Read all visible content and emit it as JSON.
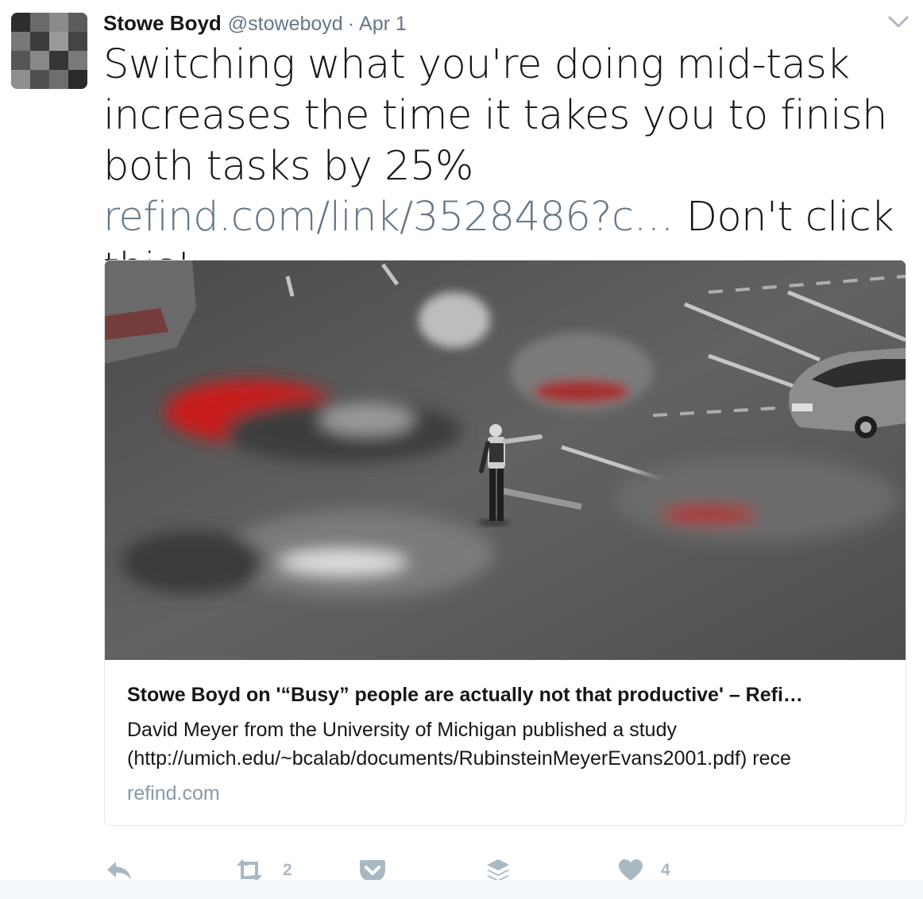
{
  "tweet": {
    "author_name": "Stowe Boyd",
    "author_handle": "@stoweboyd",
    "separator": "·",
    "date": "Apr 1",
    "text_before_link": "Switching what you're doing mid-task increases the time it takes you to finish both tasks by 25% ",
    "link_text": "refind.com/link/3528486?c…",
    "text_after_link": " Don't click this!"
  },
  "card": {
    "title": "Stowe Boyd on '“Busy” people are actually not that productive' – Refi…",
    "description_line1": "David Meyer from the University of Michigan published a study",
    "description_line2": "(http://umich.edu/~bcalab/documents/RubinsteinMeyerEvans2001.pdf) rece",
    "domain": "refind.com"
  },
  "actions": {
    "reply_icon": "reply-icon",
    "retweet_icon": "retweet-icon",
    "retweet_count": "2",
    "pocket_icon": "pocket-icon",
    "buffer_icon": "buffer-icon",
    "like_icon": "heart-icon",
    "like_count": "4"
  },
  "colors": {
    "text_primary": "#14171a",
    "text_secondary": "#657786",
    "icon_gray": "#aab8c2",
    "card_border": "#e1e8ed"
  }
}
